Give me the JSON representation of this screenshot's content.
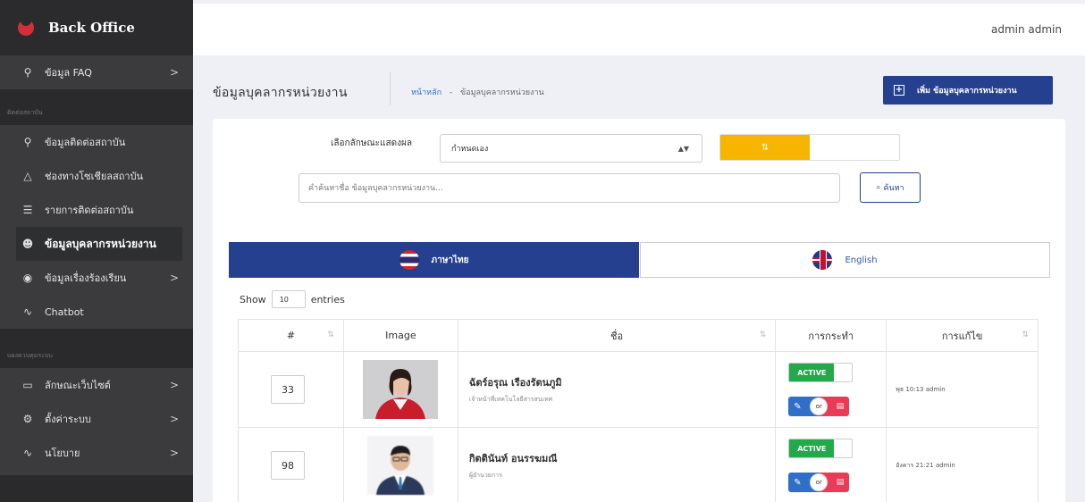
{
  "sidebar": {
    "brand": "Back Office",
    "items": [
      {
        "label": "ข้อมูล FAQ",
        "icon": "faq-icon",
        "chev": ">"
      },
      {
        "section": "ติดต่อสถาบัน"
      },
      {
        "label": "ข้อมูลติดต่อสถาบัน",
        "icon": "location-pin-icon"
      },
      {
        "label": "ช่องทางโซเชียลสถาบัน",
        "icon": "share-icon"
      },
      {
        "label": "รายการติดต่อสถาบัน",
        "icon": "list-icon"
      },
      {
        "label": "ข้อมูลบุคลากรหน่วยงาน",
        "icon": "users-icon",
        "active": true
      },
      {
        "label": "ข้อมูลเรื่องร้องเรียน",
        "icon": "complaint-icon",
        "chev": ">"
      },
      {
        "label": "Chatbot",
        "icon": "pulse-icon"
      },
      {
        "section": "แผงควบคุมระบบ"
      },
      {
        "label": "ลักษณะเว็บไซต์",
        "icon": "monitor-icon",
        "chev": ">"
      },
      {
        "label": "ตั้งค่าระบบ",
        "icon": "gear-icon",
        "chev": ">"
      },
      {
        "label": "นโยบาย",
        "icon": "pulse-icon",
        "chev": ">"
      }
    ]
  },
  "topbar": {
    "user": "admin admin"
  },
  "header": {
    "title": "ข้อมูลบุคลากรหน่วยงาน",
    "breadcrumb_home": "หน้าหลัก",
    "breadcrumb_sep": "-",
    "breadcrumb_current": "ข้อมูลบุคลากรหน่วยงาน",
    "add_button": "เพิ่ม ข้อมูลบุคลากรหน่วยงาน"
  },
  "filters": {
    "display_label": "เลือกลักษณะแสดงผล",
    "display_value": "กำหนดเอง",
    "sort_icon": "⇅",
    "search_placeholder": "คำค้นหาชื่อ ข้อมูลบุคลากรหน่วยงาน...",
    "search_button": "ค้นหา"
  },
  "lang_tabs": {
    "thai": "ภาษาไทย",
    "english": "English"
  },
  "table": {
    "show_label": "Show",
    "page_size": "10",
    "entries_label": "entries",
    "headers": [
      "#",
      "Image",
      "ชื่อ",
      "การกระทำ",
      "การแก้ไข"
    ],
    "rows": [
      {
        "num": "33",
        "name": "ฉัตร์อรุณ เรืองรัตนภูมิ",
        "role": "เจ้าหน้าที่เทคโนโลยีสารสนเทศ",
        "status": "ACTIVE",
        "edited": "พุธ 10:13 admin"
      },
      {
        "num": "98",
        "name": "กิตตินันท์ อนรรฆมณี",
        "role": "ผู้อำนวยการ",
        "status": "ACTIVE",
        "edited": "อังคาร 21:21 admin"
      }
    ],
    "or_label": "or"
  }
}
